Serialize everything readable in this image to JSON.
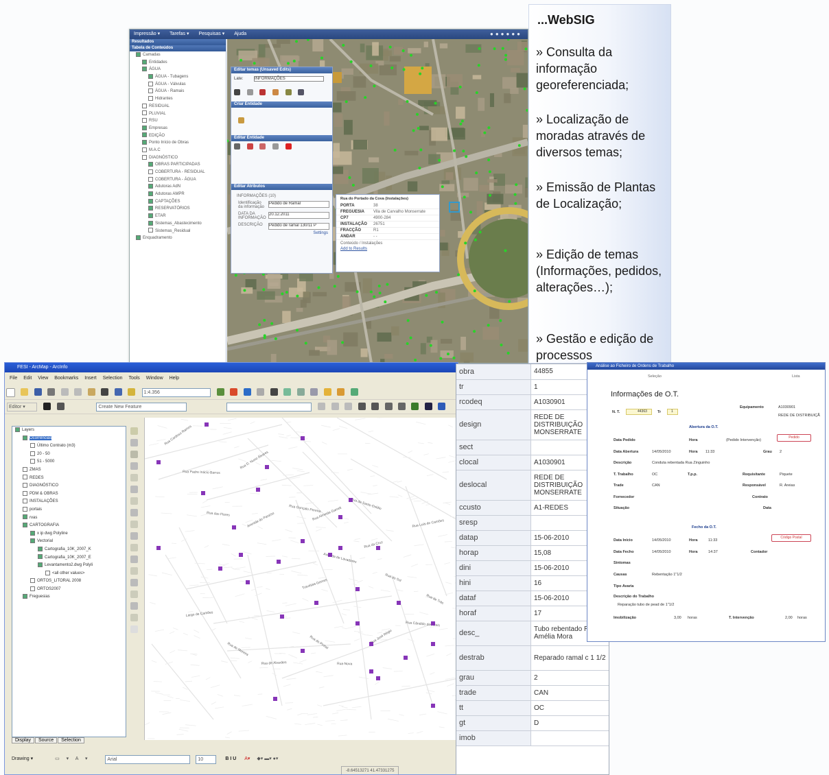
{
  "websig_window": {
    "menu": [
      "Impressão ▾",
      "Tarefas ▾",
      "Pesquisas ▾",
      "Ajuda"
    ],
    "left_header": "Resultados",
    "toc_header": "Tabela de Conteúdos",
    "layers": [
      "Camadas",
      "Entidades",
      "ÁGUA",
      "ÁGUA - Tubagens",
      "ÁGUA - Válvulas",
      "ÁGUA - Ramais",
      "Hidrantes",
      "RESIDUAL",
      "PLUVIAL",
      "RSU",
      "Empresas",
      "EDIÇÃO",
      "Ponto Início de Obras",
      "M.A.C",
      "DIAGNÓSTICO",
      "OBRAS PARTICIPADAS",
      "COBERTURA - RESIDUAL",
      "COBERTURA - ÁGUA",
      "Adutoras AdN",
      "Adutoras AMPR",
      "CAPTAÇÕES",
      "RESERVATÓRIOS",
      "ETAR",
      "Sistemas_Abastecimento",
      "Sistemas_Residual",
      "Enquadramento"
    ],
    "edit_themes_dialog": {
      "title": "Editar temas (Unsaved Edits)",
      "layer_label": "Late:",
      "layer_value": "INFORMAÇÕES",
      "section_create": "Criar Entidade",
      "section_edit": "Editar Entidade",
      "section_attrs": "Editar Atributos",
      "attr_layer": "INFORMAÇÕES (10)",
      "rows": [
        [
          "Identificação da informação",
          "Pedido de Ramal"
        ],
        [
          "DATA DA INFORMAÇÃO",
          "20.12.2011"
        ],
        [
          "DESCRIÇÃO",
          "Pedido de ramal 130/11 P"
        ]
      ],
      "link": "Settings"
    },
    "popup": {
      "title": "Rua do Portado da Cova (Instalações)",
      "rows": [
        [
          "PORTA",
          "38"
        ],
        [
          "FREGUESIA",
          "Vila de Carvalho Monserrate"
        ],
        [
          "CP7",
          "4900-284"
        ],
        [
          "INSTALAÇÃO",
          "26751"
        ],
        [
          "FRACÇÃO",
          "R1"
        ],
        [
          "ANDAR",
          "- -"
        ]
      ],
      "links": [
        "Conteúdo / Instalações",
        "Add to Results"
      ]
    }
  },
  "panel": {
    "title": "...WebSIG",
    "bullets": [
      "» Consulta da informação georeferenciada;",
      "» Localização de moradas através de diversos temas;",
      "» Emissão de Plantas de Localização;",
      "» Edição de temas (Informações, pedidos, alterações…);",
      "» Gestão e edição de processos"
    ]
  },
  "arcmap": {
    "title": "FESI - ArcMap - ArcInfo",
    "menu": [
      "File",
      "Edit",
      "View",
      "Bookmarks",
      "Insert",
      "Selection",
      "Tools",
      "Window",
      "Help"
    ],
    "scale": "1:4.356",
    "editor_label": "Editor ▾",
    "create_feature": "Create New Feature",
    "toc": [
      "Layers",
      "Ocorrências",
      "Último Contrato (m3)",
      "20 - 50",
      "51 - 5000",
      "ZMAS",
      "REDES",
      "DIAGNÓSTICO",
      "PDM & OBRAS",
      "INSTALAÇÕES",
      "portais",
      "rvas",
      "CARTOGRAFIA",
      "x ip dwg Polyline",
      "Vectorial",
      "Cartografia_10K_2007_K",
      "Cartografia_10K_2007_E",
      "Levantamento2.dwg Polyli",
      "<all other values>",
      "ORTOS_LITORAL 2008",
      "ORTOS2007",
      "Freguesias"
    ],
    "tabs": [
      "Display",
      "Source",
      "Selection"
    ],
    "drawing": "Drawing ▾",
    "font": "Arial",
    "font_size": "10",
    "status_coords": "-8.64513271  41.47331275",
    "street_labels": [
      "Rua Cardoso Ramos",
      "Rua Padre Inácio Barros",
      "Rua D. Nuno Álvares",
      "Rua das Flores",
      "Avenida do Paraíso",
      "Rua Gonçalo Pereira",
      "Rua Almeida Garrett",
      "Avenida de Lavadores",
      "Travessa Gomes",
      "Rua de Santo Ovídio",
      "Rua da Cruz",
      "Rua do Sol",
      "Rua Luís de Camões",
      "Rua de Trás",
      "Largo de Camões",
      "Rua de Moreira",
      "Rua de Alvarães",
      "Rua do Pinhal",
      "Rua Nova",
      "Rua José Régio",
      "Rua Cândido dos Reis"
    ]
  },
  "attribute_table": [
    [
      "obra",
      "44855"
    ],
    [
      "tr",
      "1"
    ],
    [
      "rcodeq",
      "A1030901"
    ],
    [
      "design",
      "REDE DE DISTRIBUIÇÃO MONSERRATE"
    ],
    [
      "sect",
      ""
    ],
    [
      "clocal",
      "A1030901"
    ],
    [
      "deslocal",
      "REDE DE DISTRIBUIÇÃO MONSERRATE"
    ],
    [
      "ccusto",
      "A1-REDES"
    ],
    [
      "sresp",
      ""
    ],
    [
      "datap",
      "15-06-2010"
    ],
    [
      "horap",
      "15,08"
    ],
    [
      "dini",
      "15-06-2010"
    ],
    [
      "hini",
      "16"
    ],
    [
      "dataf",
      "15-06-2010"
    ],
    [
      "horaf",
      "17"
    ],
    [
      "desc_",
      "Tubo rebentado Rua Amélia Mora"
    ],
    [
      "destrab",
      "Reparado ramal c 1 1/2"
    ],
    [
      "grau",
      "2"
    ],
    [
      "trade",
      "CAN"
    ],
    [
      "tt",
      "OC"
    ],
    [
      "gt",
      "D"
    ],
    [
      "imob",
      ""
    ]
  ],
  "ot_form": {
    "title": "Análise ao Ficheiro de Ordens de Trabalho",
    "tab_left": "Seleção",
    "tab_right": "Lista",
    "heading": "Informações de O.T.",
    "ot_label": "N. T.",
    "ot_value": "44363",
    "tr_label": "Tr",
    "tr_value": "1",
    "equip_label": "Equipamento",
    "equip_value": "A1030901",
    "equip_desc": "REDE DE DISTRIBUIÇÃ",
    "section_open": "Abertura da O.T.",
    "section_close": "Fecho da O.T.",
    "labels": {
      "data_pedido": "Data Pedido",
      "hora": "Hora",
      "pedido_int": "(Pedido Intervenção)",
      "pedido_btn": "Pedido",
      "data_abertura": "Data Abertura",
      "data_abertura_v": "14/05/2010",
      "hora_abertura_v": "11:33",
      "grau": "Grau",
      "grau_v": "2",
      "descricao": "Descrição",
      "descricao_v": "Conduta rebentada Rua Zinguinho",
      "t_trabalho": "T. Trabalho",
      "t_trabalho_v": "OC",
      "tpp": "T.p.p.",
      "requisitante": "Requisitante",
      "requisitante_v": "Piquete",
      "trade": "Trade",
      "trade_v": "CAN",
      "responsavel": "Responsável",
      "responsavel_v": "R. Areias",
      "fornecedor": "Fornecedor",
      "contrato": "Contrato",
      "situacao": "Situação",
      "data": "Data",
      "data_inicio": "Data Início",
      "data_inicio_v": "14/05/2010",
      "hora_inicio_v": "11:33",
      "data_fecho": "Data Fecho",
      "data_fecho_v": "14/05/2010",
      "hora_fecho_v": "14:37",
      "contador": "Contador",
      "sintomas": "Sintomas",
      "causas": "Causas",
      "causas_v": "Rebentação 1\"1/2",
      "tipo_avaria": "Tipo Avaria",
      "descr_trab": "Descrição do Trabalho",
      "descr_trab_v": "Reparação tubo de pead de 1\"1/2",
      "imobilizacao": "Imobilização",
      "imobilizacao_v": "3,00",
      "t_intervencao": "T. Intervenção",
      "t_intervencao_v": "2,00",
      "unit": "horas",
      "cod_postal_btn": "Código Postal"
    }
  }
}
